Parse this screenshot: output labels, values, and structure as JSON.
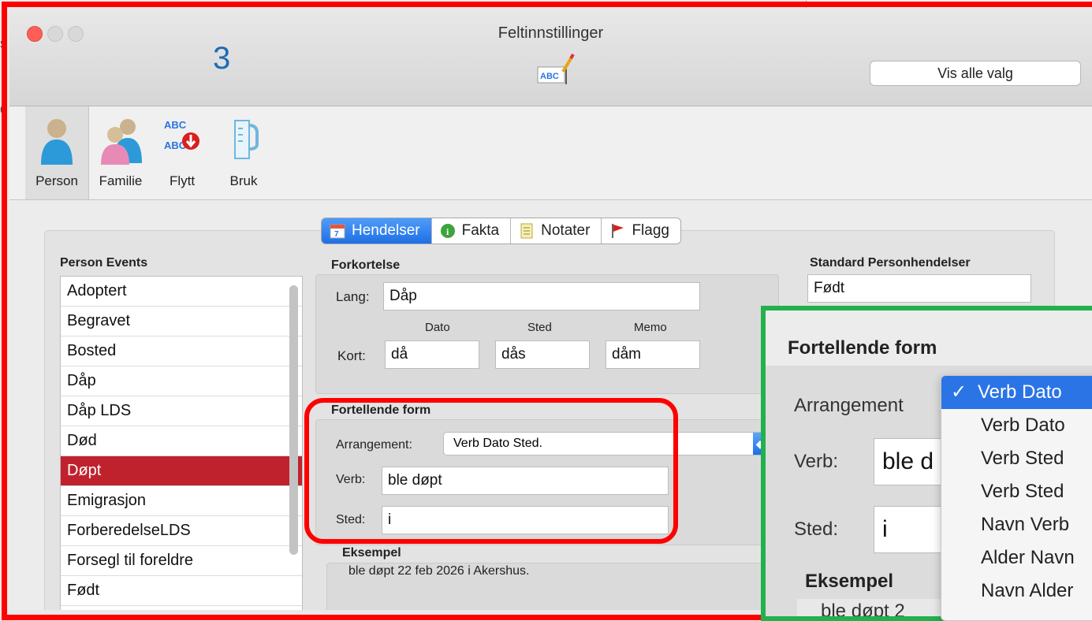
{
  "window": {
    "title": "Feltinnstillinger",
    "overlay_number": "3",
    "vis_alle_valg": "Vis alle valg",
    "edge_glyphs": [
      "s",
      "d"
    ]
  },
  "toolbar": {
    "items": [
      {
        "label": "Person",
        "icon": "person-icon",
        "selected": true
      },
      {
        "label": "Familie",
        "icon": "family-icon",
        "selected": false
      },
      {
        "label": "Flytt",
        "icon": "move-abc-icon",
        "selected": false
      },
      {
        "label": "Bruk",
        "icon": "measuring-cup-icon",
        "selected": false
      }
    ],
    "abc_text": "ABC"
  },
  "tabs": [
    {
      "label": "Hendelser",
      "icon": "calendar-icon",
      "active": true,
      "calendar_day": "7"
    },
    {
      "label": "Fakta",
      "icon": "info-icon",
      "active": false,
      "glyph": "i"
    },
    {
      "label": "Notater",
      "icon": "notepad-icon",
      "active": false
    },
    {
      "label": "Flagg",
      "icon": "flag-icon",
      "active": false
    }
  ],
  "events": {
    "header": "Person Events",
    "items": [
      "Adoptert",
      "Begravet",
      "Bosted",
      "Dåp",
      "Dåp LDS",
      "Død",
      "Døpt",
      "Emigrasjon",
      "ForberedelseLDS",
      "Forsegl til foreldre",
      "Født"
    ],
    "selected": "Døpt"
  },
  "forkortelse": {
    "header": "Forkortelse",
    "lang_label": "Lang:",
    "lang_value": "Dåp",
    "col_dato": "Dato",
    "col_sted": "Sted",
    "col_memo": "Memo",
    "kort_label": "Kort:",
    "kort_dato": "då",
    "kort_sted": "dås",
    "kort_memo": "dåm"
  },
  "fortellende": {
    "header": "Fortellende form",
    "arrangement_label": "Arrangement:",
    "arrangement_value": "Verb Dato Sted.",
    "verb_label": "Verb:",
    "verb_value": "ble døpt",
    "sted_label": "Sted:",
    "sted_value": "i"
  },
  "eksempel": {
    "header": "Eksempel",
    "text": "ble døpt 22 feb 2026 i Akershus."
  },
  "standard": {
    "header": "Standard Personhendelser",
    "value": "Født"
  },
  "zoom": {
    "header": "Fortellende form",
    "arrangement_label": "Arrangement",
    "verb_label": "Verb:",
    "verb_value": "ble d",
    "sted_label": "Sted:",
    "sted_value": "i",
    "eksempel_label": "Eksempel",
    "eksempel_text": "ble døpt 2",
    "menu_items": [
      "Verb Dato",
      "Verb Dato",
      "Verb Sted",
      "Verb Sted",
      "Navn Verb",
      "Alder Navn",
      "Navn Alder"
    ],
    "checkmark": "✓"
  },
  "colors": {
    "annotation_red": "#ff0000",
    "annotation_green": "#22b14c",
    "selection_red": "#c0222d",
    "accent_blue": "#2a74e6"
  }
}
